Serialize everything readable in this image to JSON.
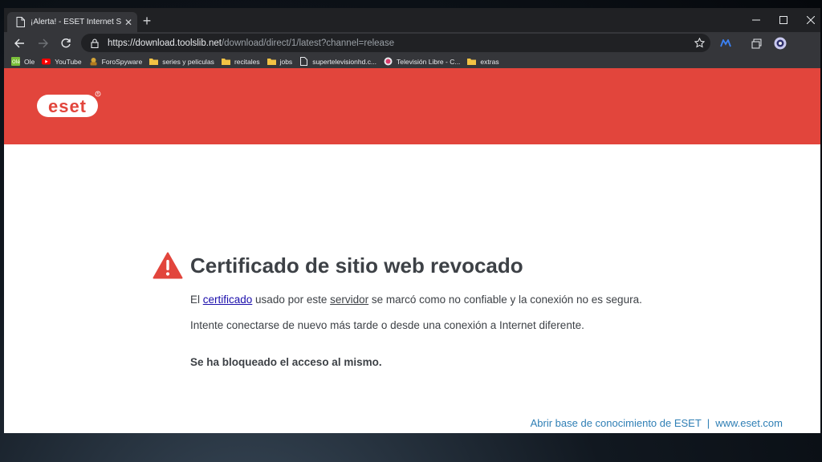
{
  "browser": {
    "tab": {
      "title": "¡Alerta! - ESET Internet Security",
      "close": "✕"
    },
    "new_tab": "+",
    "window_controls": {
      "minimize": "—",
      "maximize": "☐",
      "close": "✕"
    },
    "address": {
      "scheme": "https://",
      "host": "download.toolslib.net",
      "path": "/download/direct/1/latest?channel=release"
    },
    "icons": [
      "back-icon",
      "forward-icon",
      "refresh-icon",
      "lock-icon",
      "star-icon",
      "extension-icon",
      "collections-icon",
      "profile-icon"
    ]
  },
  "bookmarks": [
    {
      "label": "Ole",
      "icon": "ole-favicon"
    },
    {
      "label": "YouTube",
      "icon": "youtube-favicon"
    },
    {
      "label": "ForoSpyware",
      "icon": "forospyware-favicon"
    },
    {
      "label": "series y peliculas",
      "icon": "folder-icon"
    },
    {
      "label": "recitales",
      "icon": "folder-icon"
    },
    {
      "label": "jobs",
      "icon": "folder-icon"
    },
    {
      "label": "supertelevisionhd.c...",
      "icon": "page-icon"
    },
    {
      "label": "Televisión Libre - C...",
      "icon": "tvlibre-favicon"
    },
    {
      "label": "extras",
      "icon": "folder-icon"
    }
  ],
  "page": {
    "brand": "eset",
    "brand_color": "#e2453c",
    "heading": "Certificado de sitio web revocado",
    "line1": {
      "pre": "El ",
      "link1": "certificado",
      "mid": " usado por este ",
      "link2": "servidor",
      "post": " se marcó como no confiable y la conexión no es segura."
    },
    "line2": "Intente conectarse de nuevo más tarde o desde una conexión a Internet diferente.",
    "line3": "Se ha bloqueado el acceso al mismo.",
    "footer": {
      "knowledge_link": "Abrir base de conocimiento de ESET",
      "separator": "|",
      "site_link": "www.eset.com"
    }
  }
}
